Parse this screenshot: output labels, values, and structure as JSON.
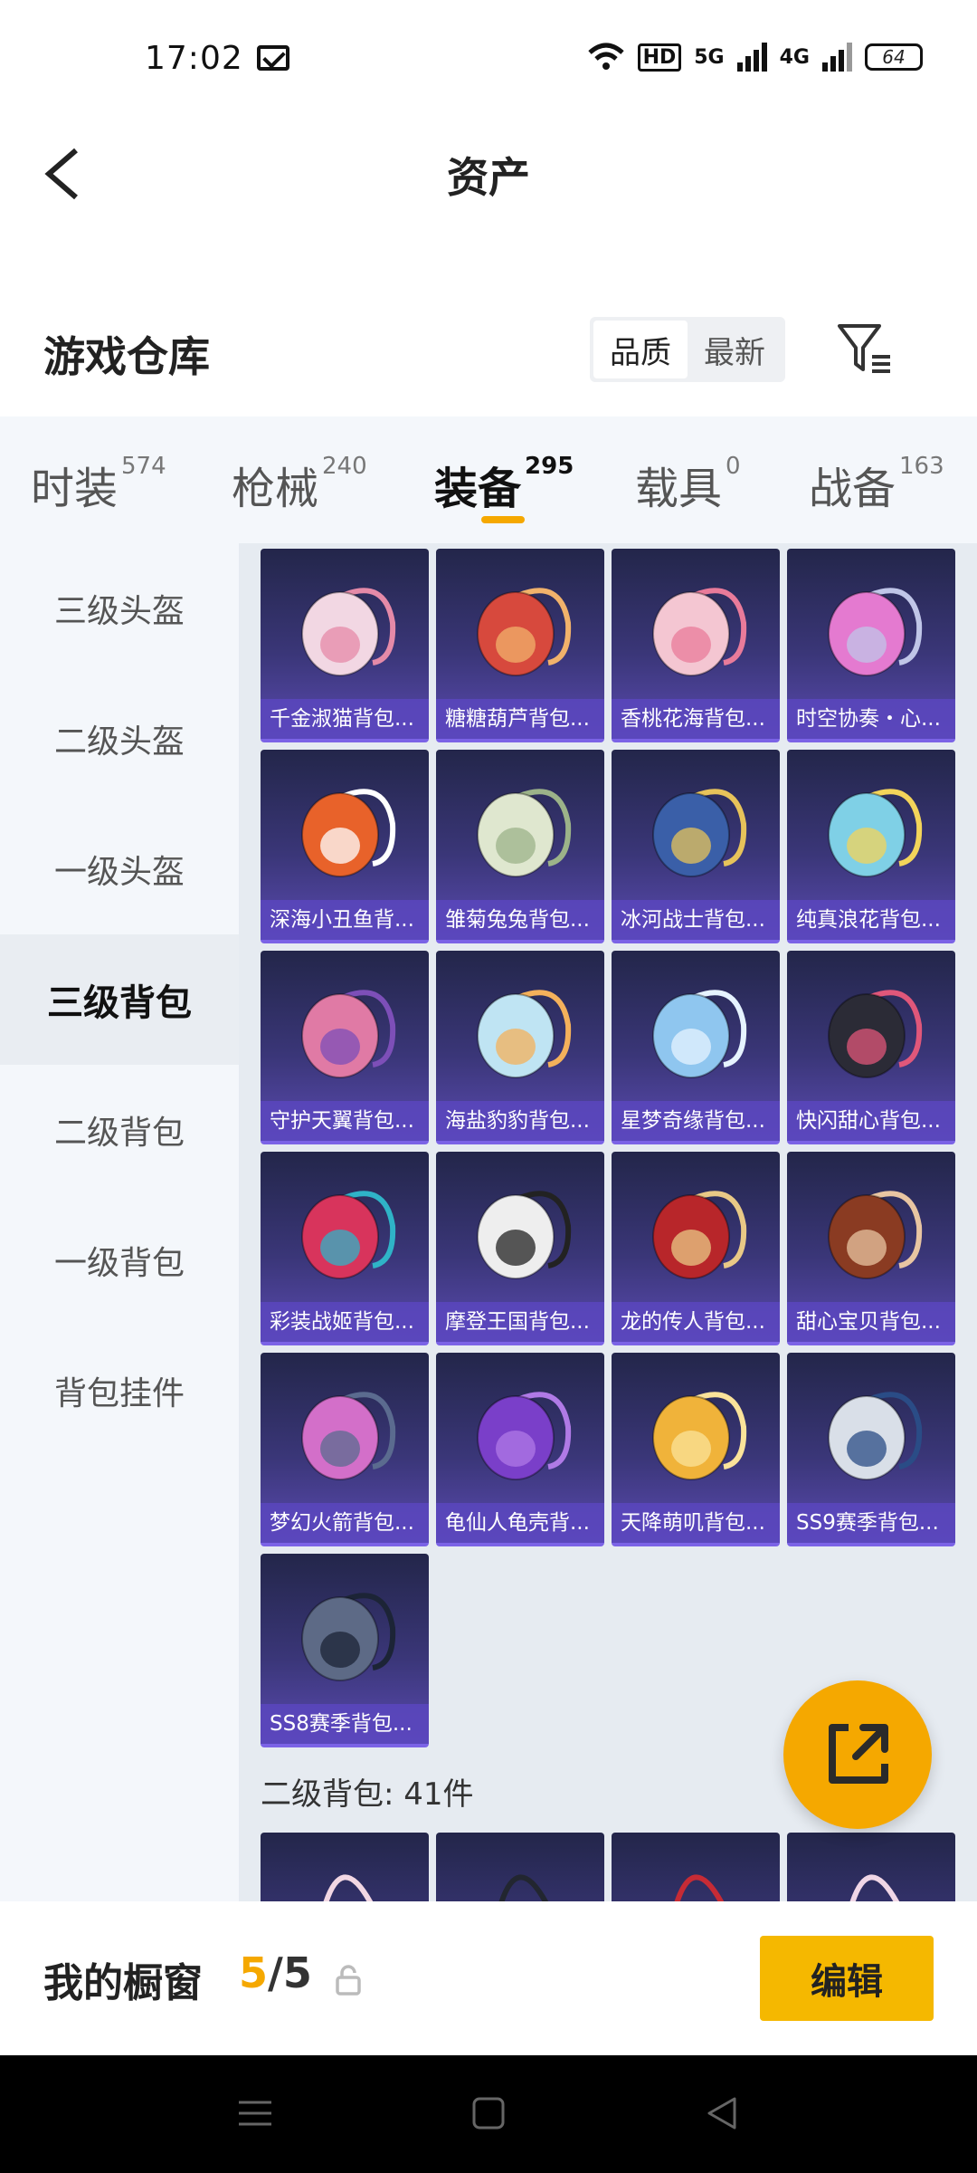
{
  "status_bar": {
    "time": "17:02",
    "hd_label": "HD",
    "net1": "5G",
    "net2": "4G",
    "battery": "64"
  },
  "header": {
    "title": "资产"
  },
  "warehouse": {
    "title": "游戏仓库",
    "sort_options": [
      "品质",
      "最新"
    ],
    "active_sort": "品质"
  },
  "tabs": [
    {
      "label": "时装",
      "count": "574"
    },
    {
      "label": "枪械",
      "count": "240"
    },
    {
      "label": "装备",
      "count": "295"
    },
    {
      "label": "载具",
      "count": "0"
    },
    {
      "label": "战备",
      "count": "163"
    }
  ],
  "active_tab": "装备",
  "sidebar": {
    "items": [
      "三级头盔",
      "二级头盔",
      "一级头盔",
      "三级背包",
      "二级背包",
      "一级背包",
      "背包挂件"
    ],
    "active": "三级背包"
  },
  "items": [
    {
      "name": "千金淑猫背包...",
      "color": "#f2d7e3",
      "accent": "#e58aa8"
    },
    {
      "name": "糖糖葫芦背包...",
      "color": "#d7493d",
      "accent": "#f1b26b"
    },
    {
      "name": "香桃花海背包...",
      "color": "#f4c6d2",
      "accent": "#e97b9a"
    },
    {
      "name": "时空协奏・心...",
      "color": "#e47ad0",
      "accent": "#c0c6e8"
    },
    {
      "name": "深海小丑鱼背...",
      "color": "#e8622a",
      "accent": "#ffffff"
    },
    {
      "name": "雏菊兔兔背包...",
      "color": "#dfe7cf",
      "accent": "#9cb389"
    },
    {
      "name": "冰河战士背包...",
      "color": "#3a5fa8",
      "accent": "#e7c35a"
    },
    {
      "name": "纯真浪花背包...",
      "color": "#7fd0e6",
      "accent": "#f3d45a"
    },
    {
      "name": "守护天翼背包...",
      "color": "#e07aa5",
      "accent": "#7d4fb8"
    },
    {
      "name": "海盐豹豹背包...",
      "color": "#bfe4f3",
      "accent": "#f4b15b"
    },
    {
      "name": "星梦奇缘背包...",
      "color": "#8fc6ef",
      "accent": "#e6f3ff"
    },
    {
      "name": "快闪甜心背包...",
      "color": "#2b2b36",
      "accent": "#e0577a"
    },
    {
      "name": "彩装战姬背包...",
      "color": "#d8345c",
      "accent": "#2fb3c7"
    },
    {
      "name": "摩登王国背包...",
      "color": "#eeeeee",
      "accent": "#222222"
    },
    {
      "name": "龙的传人背包...",
      "color": "#b8262a",
      "accent": "#e9c986"
    },
    {
      "name": "甜心宝贝背包...",
      "color": "#8a3b22",
      "accent": "#e8c5a2"
    },
    {
      "name": "梦幻火箭背包...",
      "color": "#d36fc9",
      "accent": "#5b6b8f"
    },
    {
      "name": "龟仙人龟壳背...",
      "color": "#7a3fc9",
      "accent": "#b07ae6"
    },
    {
      "name": "天降萌叽背包...",
      "color": "#f0b33a",
      "accent": "#fbe39a"
    },
    {
      "name": "SS9赛季背包...",
      "color": "#d9dfe8",
      "accent": "#2a4c86"
    },
    {
      "name": "SS8赛季背包...",
      "color": "#5d6a86",
      "accent": "#1c2436"
    }
  ],
  "next_section": {
    "label": "二级背包: 41件",
    "peek_colors": [
      "#f2d7e3",
      "#222630",
      "#c62b35",
      "#f0d6e6"
    ]
  },
  "showcase": {
    "label": "我的橱窗",
    "current": "5",
    "separator": "/",
    "max": "5",
    "edit_label": "编辑"
  }
}
